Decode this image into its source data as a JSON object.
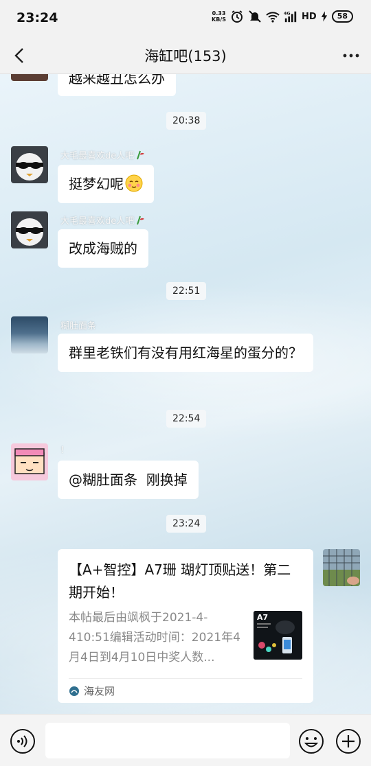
{
  "status_bar": {
    "time": "23:24",
    "net_speed_value": "0.33",
    "net_speed_unit": "KB/S",
    "network_type": "4G",
    "hd_label": "HD",
    "battery": "58"
  },
  "header": {
    "title": "海缸吧(153)"
  },
  "messages": {
    "partial_text": "越来越丑怎么办",
    "time_1": "20:38",
    "m1_sender": "大毛最喜欢de人吧",
    "m1_text": "挺梦幻呢",
    "m2_sender": "大毛最喜欢de人吧",
    "m2_text": "改成海贼的",
    "time_2": "22:51",
    "m3_sender": "糊肚面条",
    "m3_text": "群里老铁们有没有用红海星的蛋分的？",
    "time_3": "22:54",
    "m4_sender": "!",
    "m4_text": "@糊肚面条  刚换掉",
    "time_4": "23:24"
  },
  "card": {
    "title": "【A+智控】A7珊 瑚灯顶贴送！第二期开始！",
    "description": "本帖最后由飒枫于2021-4-410:51编辑活动时间：2021年4月4日到4月10日中奖人数...",
    "thumb_label": "A7",
    "source": "海友网"
  },
  "icons": {
    "back": "chevron-left-icon",
    "more": "more-dots-icon",
    "voice": "voice-icon",
    "emoji": "emoji-icon",
    "plus": "plus-icon"
  }
}
